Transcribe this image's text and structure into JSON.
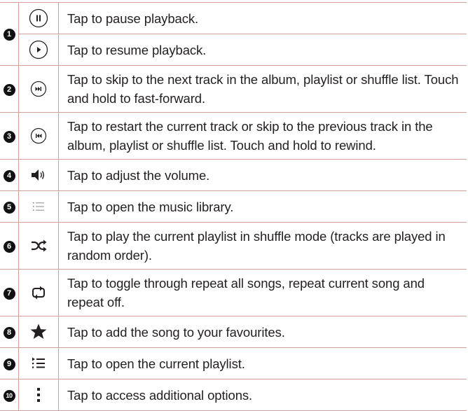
{
  "rows": [
    {
      "num": "1",
      "icon": "pause-icon",
      "text": "Tap to pause playback."
    },
    {
      "num": "",
      "icon": "play-icon",
      "text": "Tap to resume playback."
    },
    {
      "num": "2",
      "icon": "next-track-icon",
      "text": "Tap to skip to the next track in the album, playlist or shuffle list. Touch and hold to fast-forward."
    },
    {
      "num": "3",
      "icon": "previous-track-icon",
      "text": "Tap to restart the current track or skip to the previous track in the album, playlist or shuffle list. Touch and hold to rewind."
    },
    {
      "num": "4",
      "icon": "volume-icon",
      "text": "Tap to adjust the volume."
    },
    {
      "num": "5",
      "icon": "library-icon",
      "text": "Tap to open the music library."
    },
    {
      "num": "6",
      "icon": "shuffle-icon",
      "text": "Tap to play the current playlist in shuffle mode (tracks are played in random order)."
    },
    {
      "num": "7",
      "icon": "repeat-icon",
      "text": "Tap to toggle through repeat all songs, repeat current song and repeat off."
    },
    {
      "num": "8",
      "icon": "star-icon",
      "text": "Tap to add the song to your favourites."
    },
    {
      "num": "9",
      "icon": "playlist-icon",
      "text": "Tap to open the current playlist."
    },
    {
      "num": "10",
      "icon": "more-options-icon",
      "text": "Tap to access additional options."
    }
  ]
}
